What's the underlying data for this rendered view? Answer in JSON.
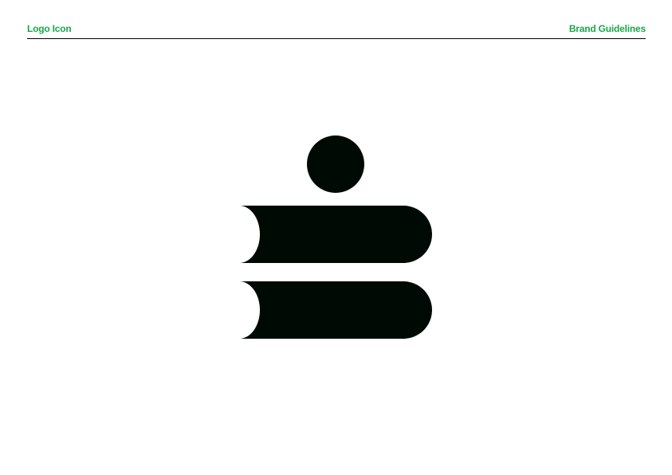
{
  "header": {
    "section_title": "Logo Icon",
    "document_title": "Brand Guidelines"
  },
  "colors": {
    "accent": "#1aa84a",
    "logo": "#000a05",
    "rule": "#000000",
    "background": "#ffffff"
  },
  "logo": {
    "icon": "stacked-books-person-icon"
  }
}
